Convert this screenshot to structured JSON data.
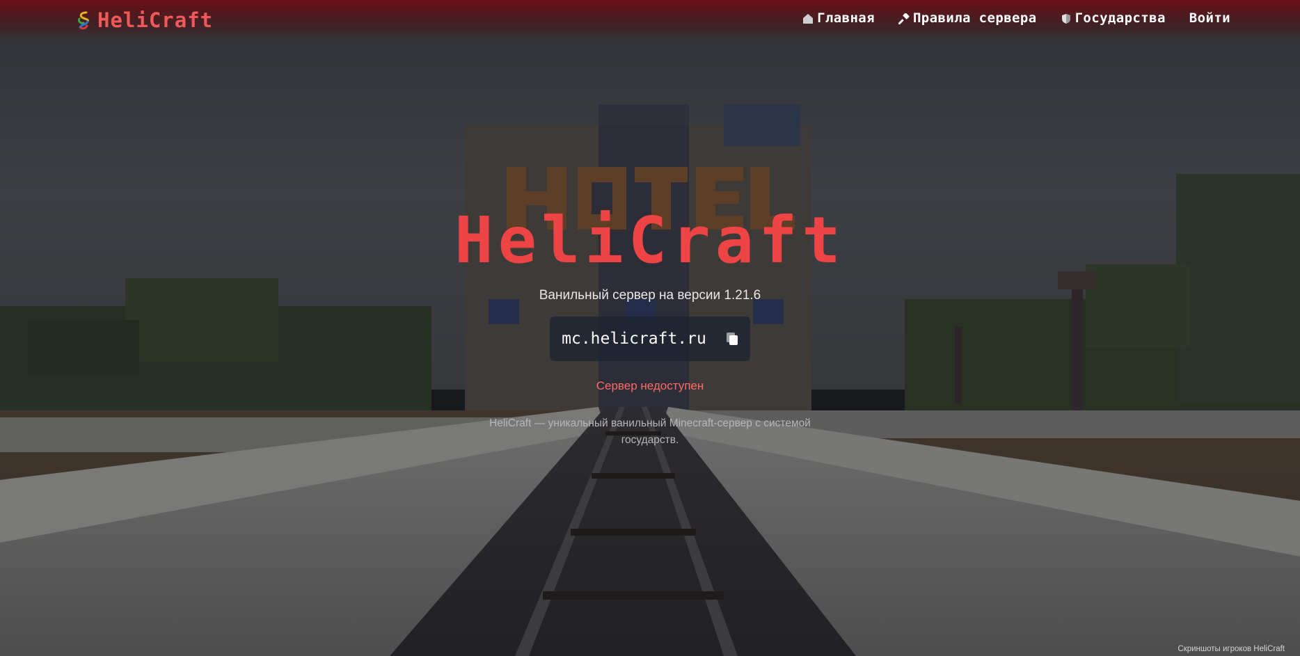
{
  "header": {
    "brand": "HeliCraft",
    "nav": [
      {
        "label": "Главная",
        "icon": "home-icon"
      },
      {
        "label": "Правила сервера",
        "icon": "hammer-icon"
      },
      {
        "label": "Государства",
        "icon": "shield-icon"
      },
      {
        "label": "Войти",
        "icon": ""
      }
    ]
  },
  "hero": {
    "title": "HeliCraft",
    "subtitle": "Ванильный сервер на версии 1.21.6",
    "server_ip": "mc.helicraft.ru",
    "copy_icon": "copy-icon",
    "status": "Сервер недоступен",
    "description": "HeliCraft — уникальный ванильный Minecraft-сервер с системой государств."
  },
  "footer": {
    "credit": "Скриншоты игроков HeliCraft"
  },
  "colors": {
    "accent": "#ee4446",
    "status_offline": "#ff6b67",
    "nav_bar": "#6e0e12",
    "ip_box": "#1c2230"
  }
}
